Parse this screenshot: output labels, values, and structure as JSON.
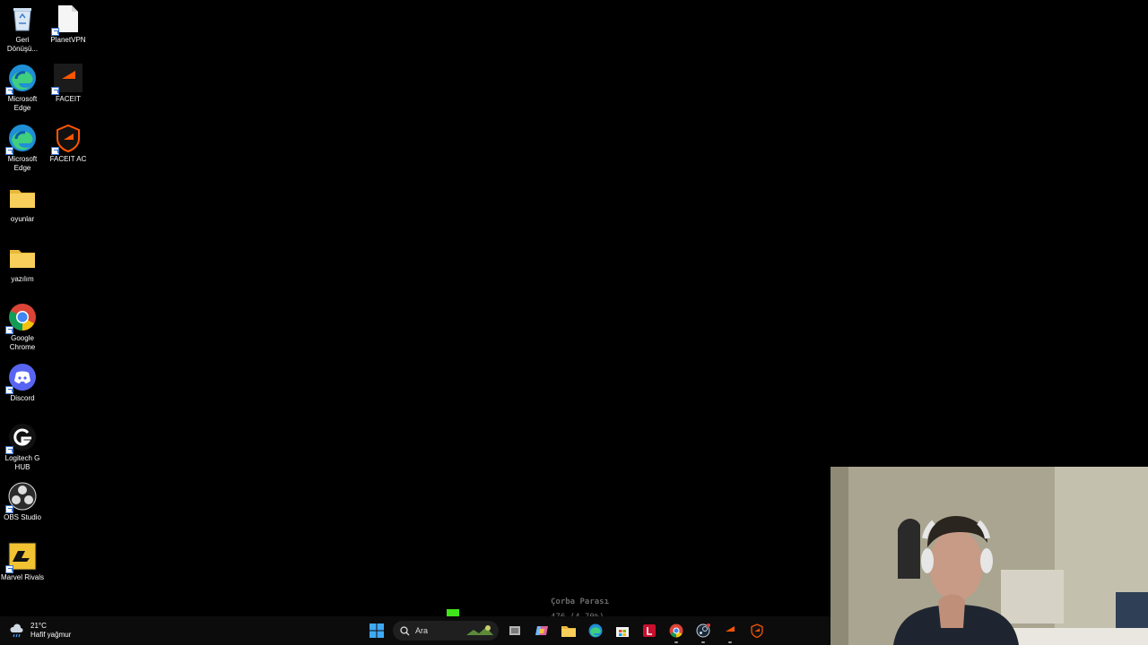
{
  "desktop": {
    "icons": [
      {
        "label": "Geri Dönüşü...",
        "icon": "recycle-bin-icon"
      },
      {
        "label": "PlanetVPN",
        "icon": "file-shortcut-icon"
      },
      {
        "label": "Microsoft Edge",
        "icon": "edge-icon"
      },
      {
        "label": "FACEIT",
        "icon": "faceit-icon"
      },
      {
        "label": "Microsoft Edge",
        "icon": "edge-icon"
      },
      {
        "label": "FACEIT AC",
        "icon": "faceit-ac-icon"
      },
      {
        "label": "oyunlar",
        "icon": "folder-icon"
      },
      {
        "label": "yazılım",
        "icon": "folder-icon"
      },
      {
        "label": "Google Chrome",
        "icon": "chrome-icon"
      },
      {
        "label": "Discord",
        "icon": "discord-icon"
      },
      {
        "label": "Logitech G HUB",
        "icon": "logitech-ghub-icon"
      },
      {
        "label": "OBS Studio",
        "icon": "obs-icon"
      },
      {
        "label": "Marvel Rivals",
        "icon": "marvel-rivals-icon"
      }
    ]
  },
  "taskbar": {
    "weather": {
      "temp": "21°C",
      "condition": "Hafif yağmur"
    },
    "search_label": "Ara",
    "apps": [
      "start-icon",
      "search",
      "game-icon",
      "files-icon",
      "copilot-icon",
      "explorer-icon",
      "edge-icon",
      "store-icon",
      "app-red-icon",
      "chrome-icon",
      "steam-icon",
      "faceit-icon",
      "faceit-ac-icon"
    ]
  },
  "overlay": {
    "title": "Çorba Parası",
    "value": "476 (4.70%)"
  },
  "colors": {
    "accent_green": "#3fe61a",
    "faceit_orange": "#ff5500",
    "taskbar_bg": "#0c0c0c"
  }
}
